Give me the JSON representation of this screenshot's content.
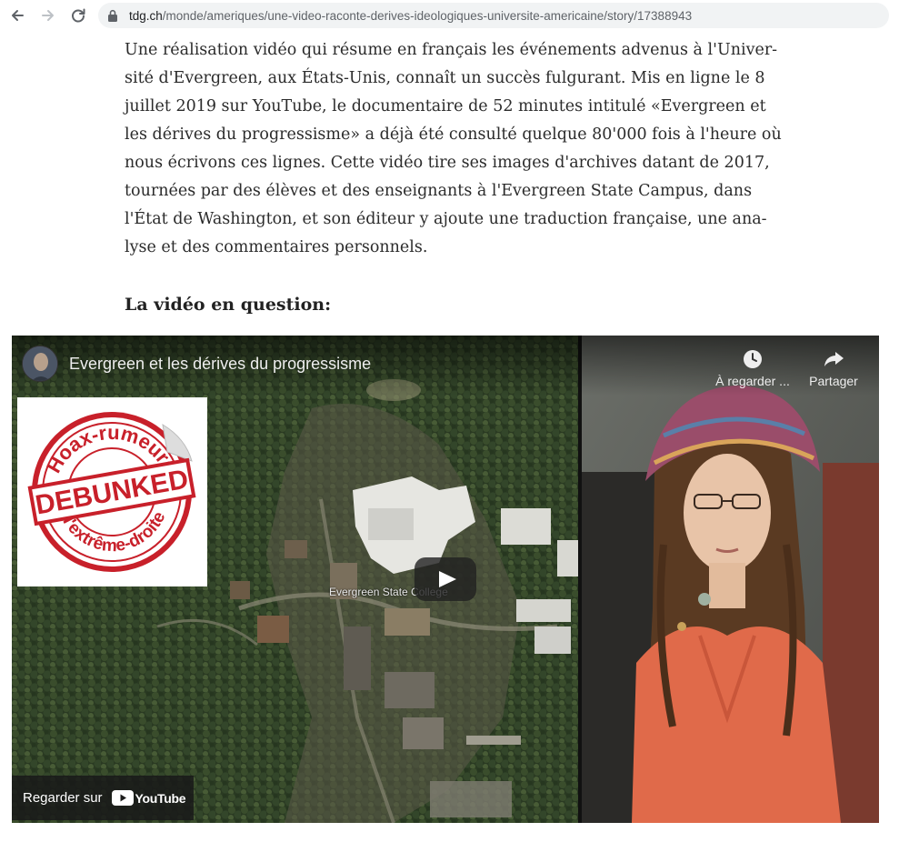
{
  "browser": {
    "url_host": "tdg.ch",
    "url_path": "/monde/ameriques/une-video-raconte-derives-ideologiques-universite-americaine/story/17388943"
  },
  "article": {
    "paragraph_lines": [
      "Une réalisation vidéo qui résume en français les événements advenus à l'Univer-",
      "sité d'Evergreen, aux États-Unis, connaît un succès fulgurant. Mis en ligne le 8",
      "juillet 2019 sur YouTube, le documentaire de 52 minutes intitulé «Evergreen et",
      "les dérives du progressisme» a déjà été consulté quelque 80'000 fois à l'heure où",
      "nous écrivons ces lignes. Cette vidéo tire ses images d'archives datant de 2017,",
      "tournées par des élèves et des enseignants à l'Evergreen State Campus, dans",
      "l'État de Washington, et son éditeur y ajoute une traduction française, une ana-",
      "lyse et des commentaires personnels."
    ],
    "subheading": "La vidéo en question:"
  },
  "video": {
    "title": "Evergreen et les dérives du progressisme",
    "watch_later_label": "À regarder ...",
    "share_label": "Partager",
    "place_label": "Evergreen State College",
    "watch_on_label": "Regarder sur",
    "youtube_wordmark": "YouTube",
    "sticker": {
      "top_text": "Hoax-rumeurs",
      "main_text": "DEBUNKED",
      "bottom_text": "d'extrême-droite"
    }
  },
  "colors": {
    "stamp_red": "#c8202a",
    "youtube_red": "#ff0000",
    "article_text": "#2b2b2b"
  }
}
